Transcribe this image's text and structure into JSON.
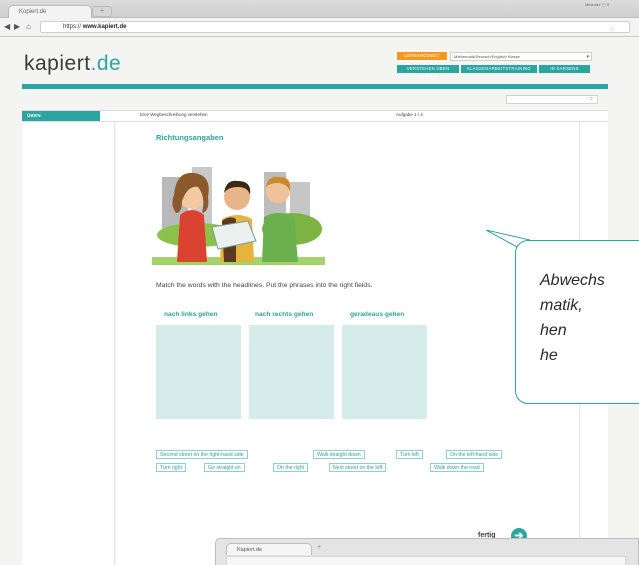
{
  "browser": {
    "tab_title": "Kopiert.de",
    "new_tab_symbol": "+",
    "window_controls": "Minimize ▢ X",
    "url_prefix": "https://",
    "url_host": "www.kapiert.de",
    "back_icon": "back-arrow-icon",
    "forward_icon": "forward-arrow-icon",
    "home_icon": "home-icon"
  },
  "site": {
    "logo_main": "kapiert",
    "logo_tld": ".de",
    "nav": {
      "pill_orange": "LERNANGEBOT",
      "subject_select": "Mathematik/Deutsch/Englisch Klasse",
      "pill_1": "VERSTEHEN ÜBEN TESTEN",
      "pill_2": "KLASSENARBEITSTRAINING",
      "pill_3": "IN KARSENS"
    },
    "header": {
      "ueben_label": "ÜBEN",
      "lesson_title": "Eine Wegbeschreibung verstehen",
      "task_counter": "Aufgabe 1 / 4"
    },
    "exercise": {
      "section_title": "Richtungsangaben",
      "instructions": "Match the words with the headlines. Put the phrases into the right fields.",
      "columns": [
        "nach links gehen",
        "nach rechts gehen",
        "geradeaus gehen"
      ],
      "chips_row1": [
        "Second street on the right-hand side",
        "Walk straight down",
        "Turn left",
        "On the left-hand side"
      ],
      "chips_row2": [
        "Turn right",
        "Go straight on",
        "On the right",
        "Next street on the left",
        "Walk down the road"
      ],
      "finish_label": "fertig"
    }
  },
  "callout": {
    "text": "Abwechs matik, hen he"
  },
  "second_window": {
    "tab_title": "Kapiert.de",
    "new_tab_symbol": "+"
  },
  "colors": {
    "brand_teal": "#2aa5a0",
    "orange": "#f39a1e",
    "drop_zone": "#d5ecea"
  }
}
